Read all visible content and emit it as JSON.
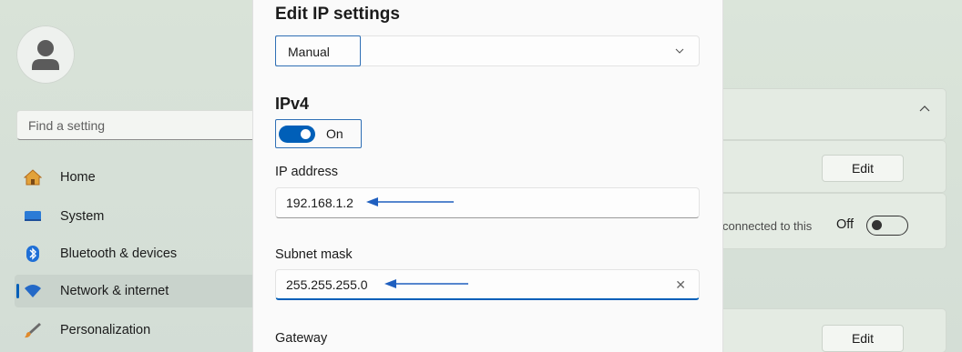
{
  "sidebar": {
    "search_placeholder": "Find a setting",
    "items": [
      {
        "label": "Home",
        "icon": "home-icon"
      },
      {
        "label": "System",
        "icon": "system-monitor-icon"
      },
      {
        "label": "Bluetooth & devices",
        "icon": "bluetooth-icon"
      },
      {
        "label": "Network & internet",
        "icon": "wifi-icon",
        "active": true
      },
      {
        "label": "Personalization",
        "icon": "brush-icon"
      }
    ]
  },
  "background": {
    "edit_label_1": "Edit",
    "edit_label_2": "Edit",
    "connected_text": "connected to this",
    "off_label": "Off"
  },
  "dialog": {
    "title": "Edit IP settings",
    "mode_value": "Manual",
    "section_title": "IPv4",
    "toggle_label": "On",
    "ip_label": "IP address",
    "ip_value": "192.168.1.2",
    "subnet_label": "Subnet mask",
    "subnet_value": "255.255.255.0",
    "clear_glyph": "✕",
    "gateway_label": "Gateway"
  },
  "colors": {
    "accent": "#005fb8",
    "annotation_arrow": "#1f5fbf"
  }
}
